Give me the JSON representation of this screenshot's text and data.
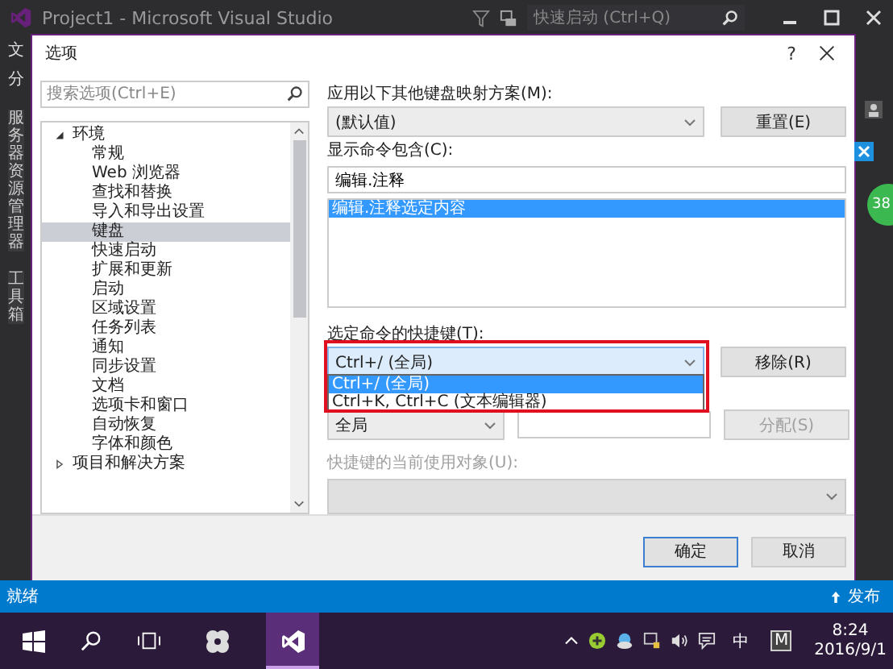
{
  "app_window": {
    "title": "Project1 - Microsoft Visual Studio",
    "quick_launch": {
      "placeholder": "快速启动 (Ctrl+Q)"
    },
    "menu_fragments": [
      "文",
      "分"
    ],
    "side_tabs": [
      "服务器资源管理器",
      "工具箱"
    ],
    "badge": "38"
  },
  "dialog": {
    "title": "选项",
    "help": "?",
    "search": {
      "placeholder": "搜索选项(Ctrl+E)"
    },
    "tree": [
      {
        "label": "环境",
        "expanded": true,
        "children": [
          {
            "label": "常规",
            "selected": false
          },
          {
            "label": "Web 浏览器",
            "selected": false
          },
          {
            "label": "查找和替换",
            "selected": false
          },
          {
            "label": "导入和导出设置",
            "selected": false
          },
          {
            "label": "键盘",
            "selected": true
          },
          {
            "label": "快速启动",
            "selected": false
          },
          {
            "label": "扩展和更新",
            "selected": false
          },
          {
            "label": "启动",
            "selected": false
          },
          {
            "label": "区域设置",
            "selected": false
          },
          {
            "label": "任务列表",
            "selected": false
          },
          {
            "label": "通知",
            "selected": false
          },
          {
            "label": "同步设置",
            "selected": false
          },
          {
            "label": "文档",
            "selected": false
          },
          {
            "label": "选项卡和窗口",
            "selected": false
          },
          {
            "label": "自动恢复",
            "selected": false
          },
          {
            "label": "字体和颜色",
            "selected": false
          }
        ]
      },
      {
        "label": "项目和解决方案",
        "expanded": false
      }
    ],
    "scheme": {
      "label": "应用以下其他键盘映射方案(M):",
      "value": "(默认值)",
      "button": "重置(E)"
    },
    "command_filter": {
      "label": "显示命令包含(C):",
      "value": "编辑.注释",
      "commands": [
        {
          "text": "编辑.注释选定内容",
          "selected": true
        }
      ]
    },
    "shortcuts": {
      "label": "选定命令的快捷键(T):",
      "value": "Ctrl+/ (全局)",
      "open": true,
      "highlighted": true,
      "button": "移除(R)",
      "options": [
        {
          "text": "Ctrl+/ (全局)",
          "selected": true
        },
        {
          "text": "Ctrl+K, Ctrl+C (文本编辑器)",
          "selected": false
        }
      ]
    },
    "new_shortcut": {
      "scope": "全局",
      "button": "分配(S)",
      "button_disabled": true
    },
    "used_by": {
      "label": "快捷键的当前使用对象(U):",
      "disabled": true
    },
    "buttons": [
      {
        "label": "确定",
        "default": true
      },
      {
        "label": "取消",
        "default": false
      }
    ]
  },
  "status_bar": {
    "text": "就绪",
    "publish": "发布"
  },
  "taskbar": {
    "apps": [
      {
        "kind": "fan",
        "active": false
      },
      {
        "kind": "vs",
        "active": true
      }
    ],
    "ime": "中",
    "key": "M",
    "time": "8:24",
    "date": "2016/9/1"
  }
}
